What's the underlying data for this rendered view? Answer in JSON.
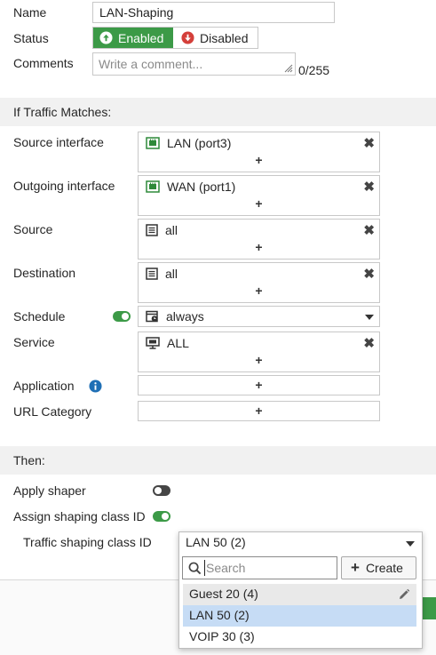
{
  "form": {
    "name_label": "Name",
    "name_value": "LAN-Shaping",
    "status_label": "Status",
    "status_enabled": "Enabled",
    "status_disabled": "Disabled",
    "comments_label": "Comments",
    "comments_placeholder": "Write a comment...",
    "comments_count": "0/255"
  },
  "match": {
    "header": "If Traffic Matches:",
    "source_interface_label": "Source interface",
    "source_interface_value": "LAN (port3)",
    "outgoing_interface_label": "Outgoing interface",
    "outgoing_interface_value": "WAN (port1)",
    "source_label": "Source",
    "source_value": "all",
    "destination_label": "Destination",
    "destination_value": "all",
    "schedule_label": "Schedule",
    "schedule_value": "always",
    "service_label": "Service",
    "service_value": "ALL",
    "application_label": "Application",
    "url_category_label": "URL Category",
    "add_symbol": "+",
    "remove_symbol": "✖"
  },
  "then": {
    "header": "Then:",
    "apply_shaper_label": "Apply shaper",
    "assign_class_label": "Assign shaping class ID",
    "class_id_label": "Traffic shaping class ID",
    "class_id_value": "LAN 50 (2)"
  },
  "dropdown": {
    "search_placeholder": "Search",
    "create_label": "Create",
    "options": [
      "Guest 20 (4)",
      "LAN 50 (2)",
      "VOIP 30 (3)"
    ],
    "selected_index": 1
  },
  "colors": {
    "accent_green": "#3c9a47",
    "disabled_red": "#d43f3a",
    "info_blue": "#1f6fb5",
    "selected_row": "#c6dcf5"
  }
}
